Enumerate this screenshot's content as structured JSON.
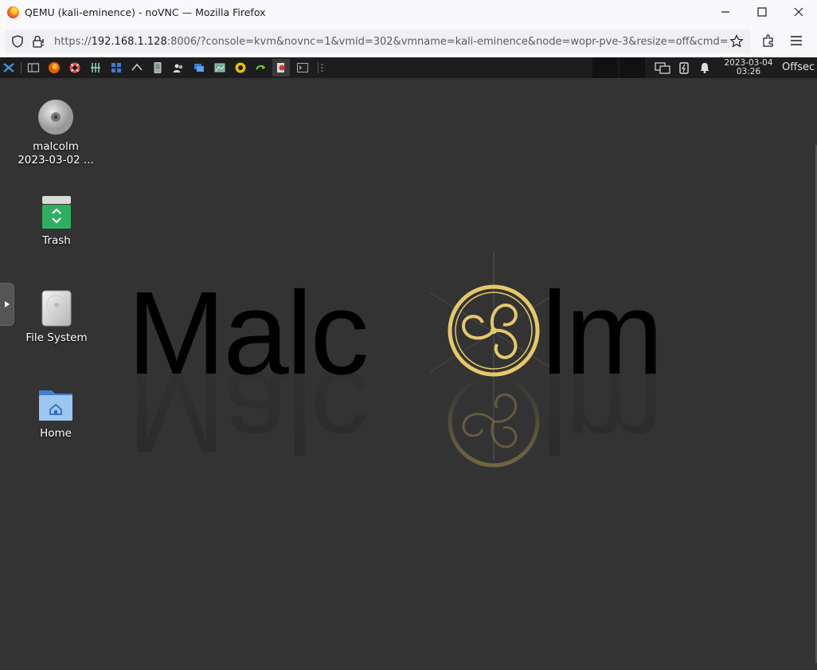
{
  "window": {
    "title": "QEMU (kali-eminence) - noVNC — Mozilla Firefox",
    "url_prefix": "https://",
    "url_host": "192.168.1.128",
    "url_rest": ":8006/?console=kvm&novnc=1&vmid=302&vmname=kali-eminence&node=wopr-pve-3&resize=off&cmd="
  },
  "panel": {
    "date": "2023-03-04",
    "time": "03:26",
    "user": "Offsec"
  },
  "desktop_icons": [
    {
      "label_line1": "malcolm",
      "label_line2": "2023-03-02 ...",
      "icon": "optical-disc-icon"
    },
    {
      "label": "Trash",
      "icon": "trash-icon"
    },
    {
      "label": "File System",
      "icon": "drive-icon"
    },
    {
      "label": "Home",
      "icon": "home-folder-icon"
    }
  ],
  "wallpaper": {
    "brand_text": "Malc",
    "brand_text_end": "lm",
    "accent": "#e6c86a"
  },
  "colors": {
    "desktop_bg": "#333333",
    "panel_bg": "#1d1d1d",
    "firefox_chrome": "#f9f9fb"
  }
}
